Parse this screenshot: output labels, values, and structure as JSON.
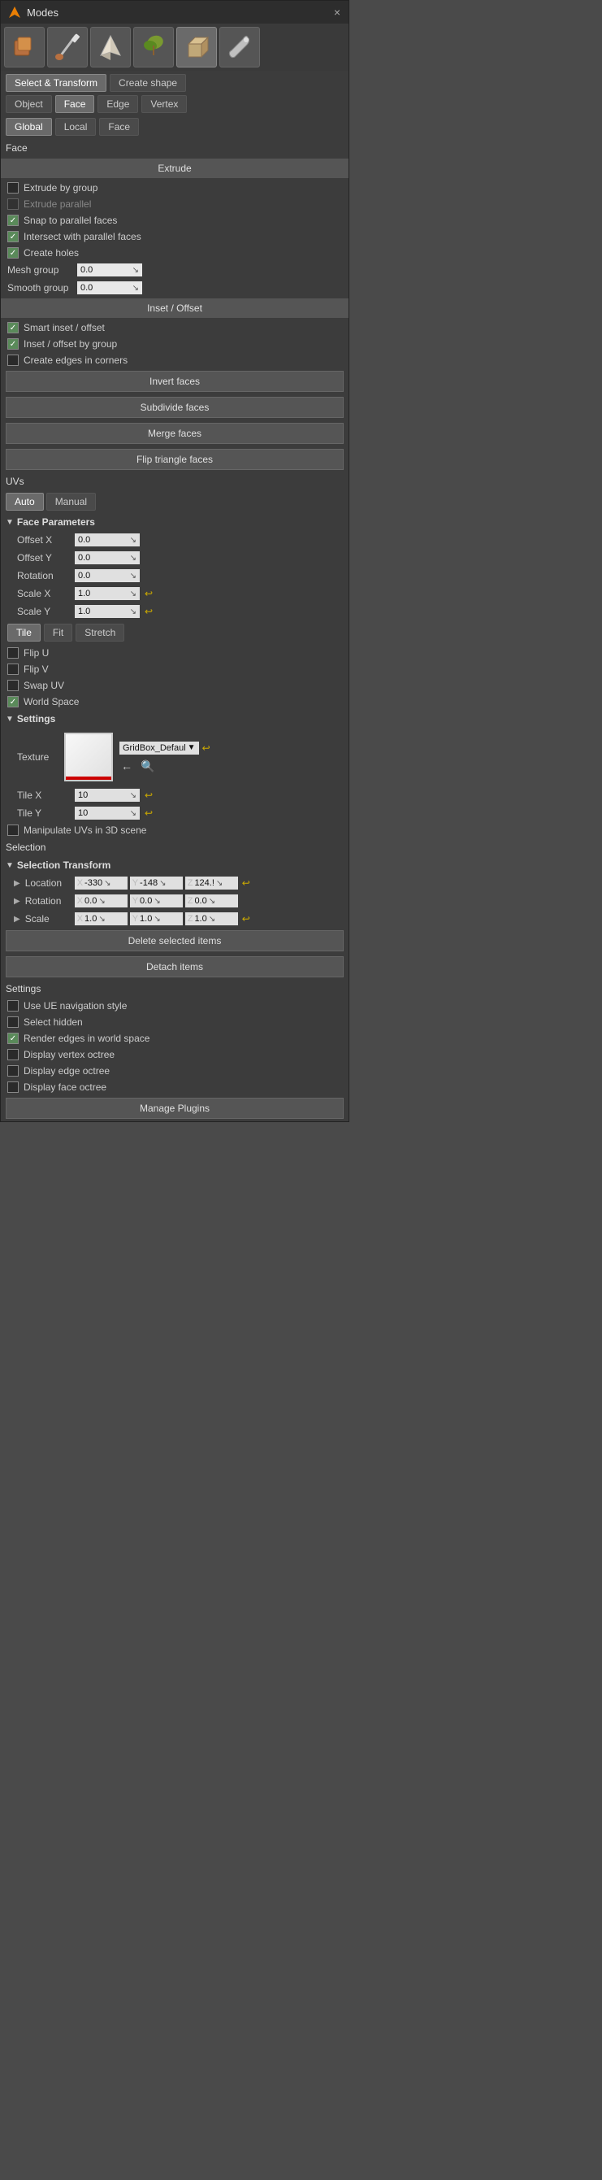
{
  "window": {
    "title": "Modes",
    "close_label": "×"
  },
  "mode_icons": [
    {
      "name": "transform-icon",
      "symbol": "🟫"
    },
    {
      "name": "paint-icon",
      "symbol": "🖌"
    },
    {
      "name": "sculpt-icon",
      "symbol": "⛰"
    },
    {
      "name": "foliage-icon",
      "symbol": "🍃"
    },
    {
      "name": "mesh-icon",
      "symbol": "📦"
    },
    {
      "name": "settings-icon",
      "symbol": "🔧"
    }
  ],
  "top_tabs": {
    "tab1": "Select & Transform",
    "tab2": "Create shape"
  },
  "sub_tabs": {
    "tab1": "Object",
    "tab2": "Face",
    "tab3": "Edge",
    "tab4": "Vertex"
  },
  "coord_tabs": {
    "tab1": "Global",
    "tab2": "Local",
    "tab3": "Face"
  },
  "face_label": "Face",
  "extrude_section": "Extrude",
  "extrude_by_group": {
    "label": "Extrude by group",
    "checked": false
  },
  "extrude_parallel": {
    "label": "Extrude parallel",
    "checked": false,
    "disabled": true
  },
  "snap_parallel": {
    "label": "Snap to parallel faces",
    "checked": true
  },
  "intersect_parallel": {
    "label": "Intersect with parallel faces",
    "checked": true
  },
  "create_holes": {
    "label": "Create holes",
    "checked": true
  },
  "mesh_group": {
    "label": "Mesh group",
    "value": "0.0"
  },
  "smooth_group": {
    "label": "Smooth group",
    "value": "0.0"
  },
  "inset_offset_section": "Inset / Offset",
  "smart_inset": {
    "label": "Smart inset / offset",
    "checked": true
  },
  "inset_by_group": {
    "label": "Inset / offset by group",
    "checked": true
  },
  "create_edges_corners": {
    "label": "Create edges in corners",
    "checked": false
  },
  "invert_faces_btn": "Invert faces",
  "subdivide_faces_btn": "Subdivide faces",
  "merge_faces_btn": "Merge faces",
  "flip_triangle_btn": "Flip triangle faces",
  "uvs_label": "UVs",
  "uvs_tabs": {
    "auto": "Auto",
    "manual": "Manual"
  },
  "face_params_title": "Face Parameters",
  "offset_x": {
    "label": "Offset X",
    "value": "0.0"
  },
  "offset_y": {
    "label": "Offset Y",
    "value": "0.0"
  },
  "rotation_uv": {
    "label": "Rotation",
    "value": "0.0"
  },
  "scale_x": {
    "label": "Scale X",
    "value": "1.0"
  },
  "scale_y": {
    "label": "Scale Y",
    "value": "1.0"
  },
  "tile_stretch_row": {
    "tile": "Tile",
    "fit": "Fit",
    "stretch": "Stretch"
  },
  "flip_u": {
    "label": "Flip U",
    "checked": false
  },
  "flip_v": {
    "label": "Flip V",
    "checked": false
  },
  "swap_uv": {
    "label": "Swap UV",
    "checked": false
  },
  "world_space": {
    "label": "World Space",
    "checked": true
  },
  "settings_title": "Settings",
  "texture_label": "Texture",
  "texture_dropdown": "GridBox_Defaul",
  "tile_x": {
    "label": "Tile X",
    "value": "10"
  },
  "tile_y": {
    "label": "Tile Y",
    "value": "10"
  },
  "manipulate_uvs": {
    "label": "Manipulate UVs in 3D scene",
    "checked": false
  },
  "selection_label": "Selection",
  "selection_transform_title": "Selection Transform",
  "location": {
    "label": "Location",
    "x": "-330",
    "y": "-148",
    "z": "124.!"
  },
  "rotation_sel": {
    "label": "Rotation",
    "x": "0.0",
    "y": "0.0",
    "z": "0.0"
  },
  "scale_sel": {
    "label": "Scale",
    "x": "1.0",
    "y": "1.0",
    "z": "1.0"
  },
  "delete_selected_btn": "Delete selected items",
  "detach_items_btn": "Detach items",
  "settings2_label": "Settings",
  "use_ue_nav": {
    "label": "Use UE navigation style",
    "checked": false
  },
  "select_hidden": {
    "label": "Select hidden",
    "checked": false
  },
  "render_edges": {
    "label": "Render edges in world space",
    "checked": true
  },
  "display_vertex": {
    "label": "Display vertex octree",
    "checked": false
  },
  "display_edge": {
    "label": "Display edge octree",
    "checked": false
  },
  "display_face": {
    "label": "Display face octree",
    "checked": false
  },
  "manage_plugins_btn": "Manage Plugins"
}
